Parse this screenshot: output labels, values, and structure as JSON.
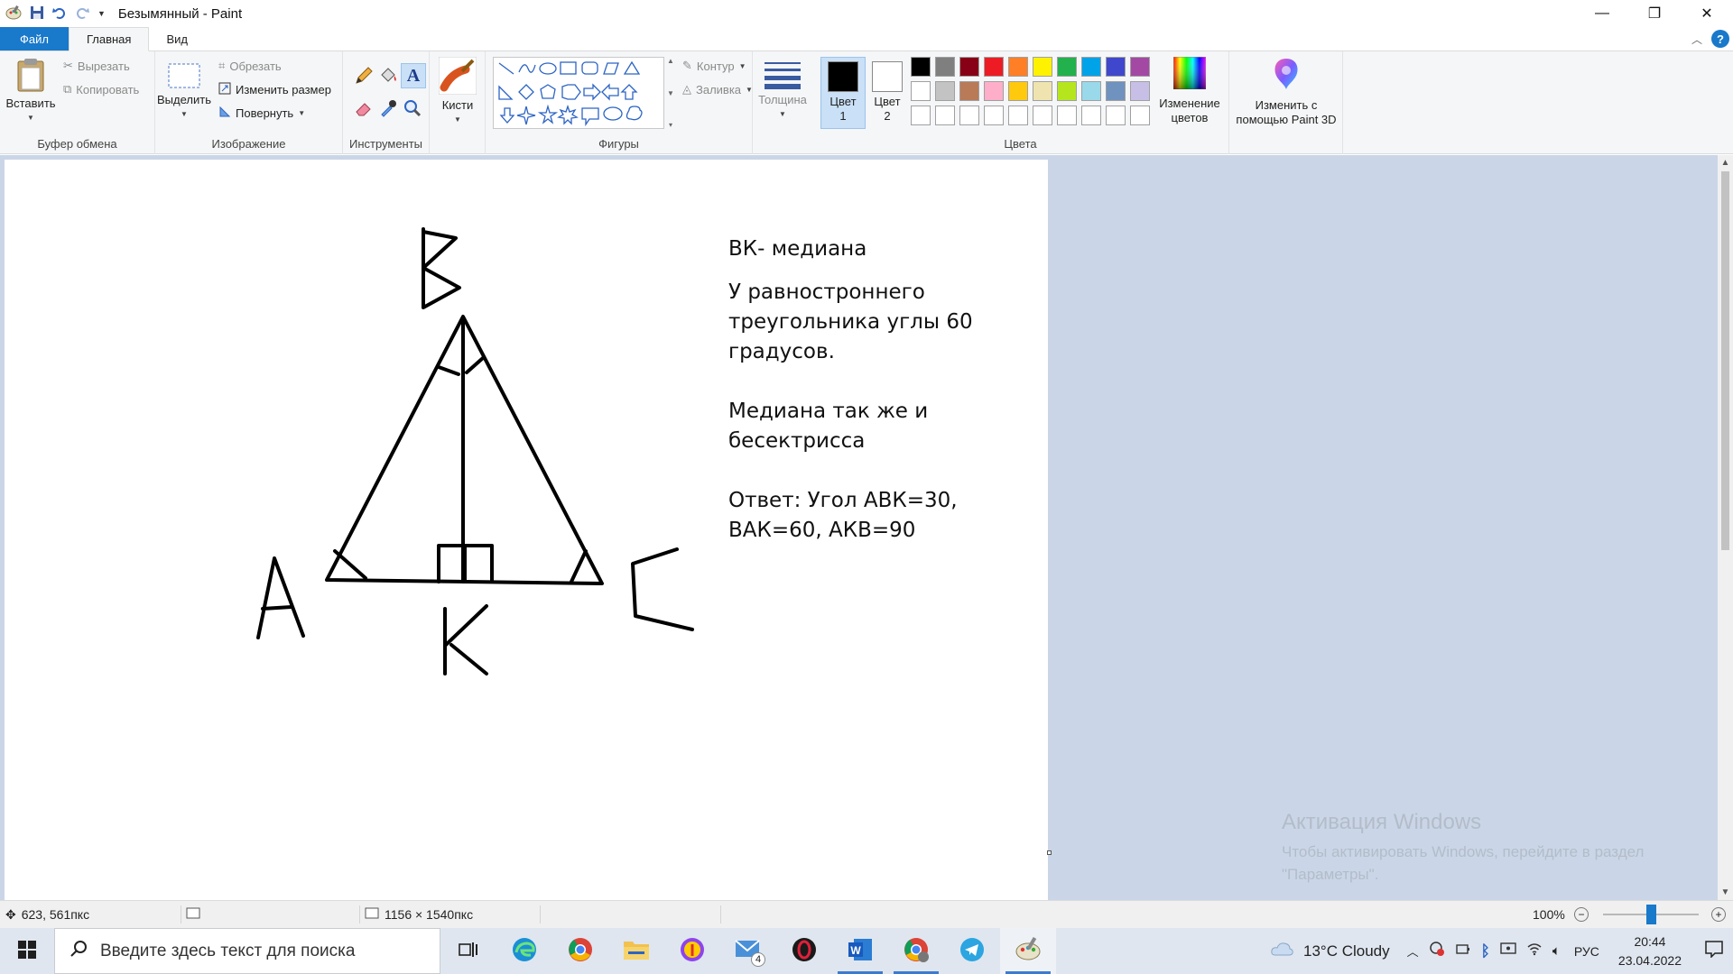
{
  "window": {
    "title": "Безымянный - Paint",
    "controls": {
      "minimize": "—",
      "maximize": "❐",
      "close": "✕"
    }
  },
  "tabs": [
    {
      "label": "Файл"
    },
    {
      "label": "Главная"
    },
    {
      "label": "Вид"
    }
  ],
  "ribbon": {
    "clipboard": {
      "paste": "Вставить",
      "cut": "Вырезать",
      "copy": "Копировать",
      "label": "Буфер обмена"
    },
    "image": {
      "select": "Выделить",
      "crop": "Обрезать",
      "resize": "Изменить размер",
      "rotate": "Повернуть",
      "label": "Изображение"
    },
    "tools": {
      "label": "Инструменты"
    },
    "brushes": {
      "label": "Кисти"
    },
    "shapes": {
      "outline": "Контур",
      "fill": "Заливка",
      "label": "Фигуры"
    },
    "size": {
      "label": "Толщина"
    },
    "colors": {
      "color1_label": "Цвет",
      "color1_num": "1",
      "color2_label": "Цвет",
      "color2_num": "2",
      "color1": "#000000",
      "color2": "#ffffff",
      "edit_label_1": "Изменение",
      "edit_label_2": "цветов",
      "label": "Цвета",
      "palette": [
        "#000000",
        "#7f7f7f",
        "#880015",
        "#ed1c24",
        "#ff7f27",
        "#fff200",
        "#22b14c",
        "#00a2e8",
        "#3f48cc",
        "#a349a4",
        "#ffffff",
        "#c3c3c3",
        "#b97a57",
        "#ffaec9",
        "#ffc90e",
        "#efe4b0",
        "#b5e61d",
        "#99d9ea",
        "#7092be",
        "#c8bfe7",
        "#ffffff",
        "#ffffff",
        "#ffffff",
        "#ffffff",
        "#ffffff",
        "#ffffff",
        "#ffffff",
        "#ffffff",
        "#ffffff",
        "#ffffff"
      ]
    },
    "paint3d": {
      "line1": "Изменить с",
      "line2": "помощью Paint 3D"
    }
  },
  "canvas": {
    "letters": {
      "b": "В",
      "a": "А",
      "c": "С",
      "k": "К"
    },
    "text_lines": [
      "ВК- медиана",
      "У равностроннего",
      "треугольника углы 60",
      "градусов.",
      "Медиана так же и",
      "бесектрисса",
      "Ответ: Угол АВК=30,",
      "ВАК=60, АКВ=90"
    ]
  },
  "watermark": {
    "title": "Активация Windows",
    "line1": "Чтобы активировать Windows, перейдите в раздел",
    "line2": "\"Параметры\"."
  },
  "status": {
    "cursor_pos": "623, 561пкс",
    "image_size": "1156 × 1540пкс",
    "zoom": "100%",
    "zoom_level": 0.5
  },
  "taskbar": {
    "search_placeholder": "Введите здесь текст для поиска",
    "weather": "13°C  Cloudy",
    "language": "РУС",
    "time": "20:44",
    "date": "23.04.2022",
    "mail_badge": "4"
  }
}
